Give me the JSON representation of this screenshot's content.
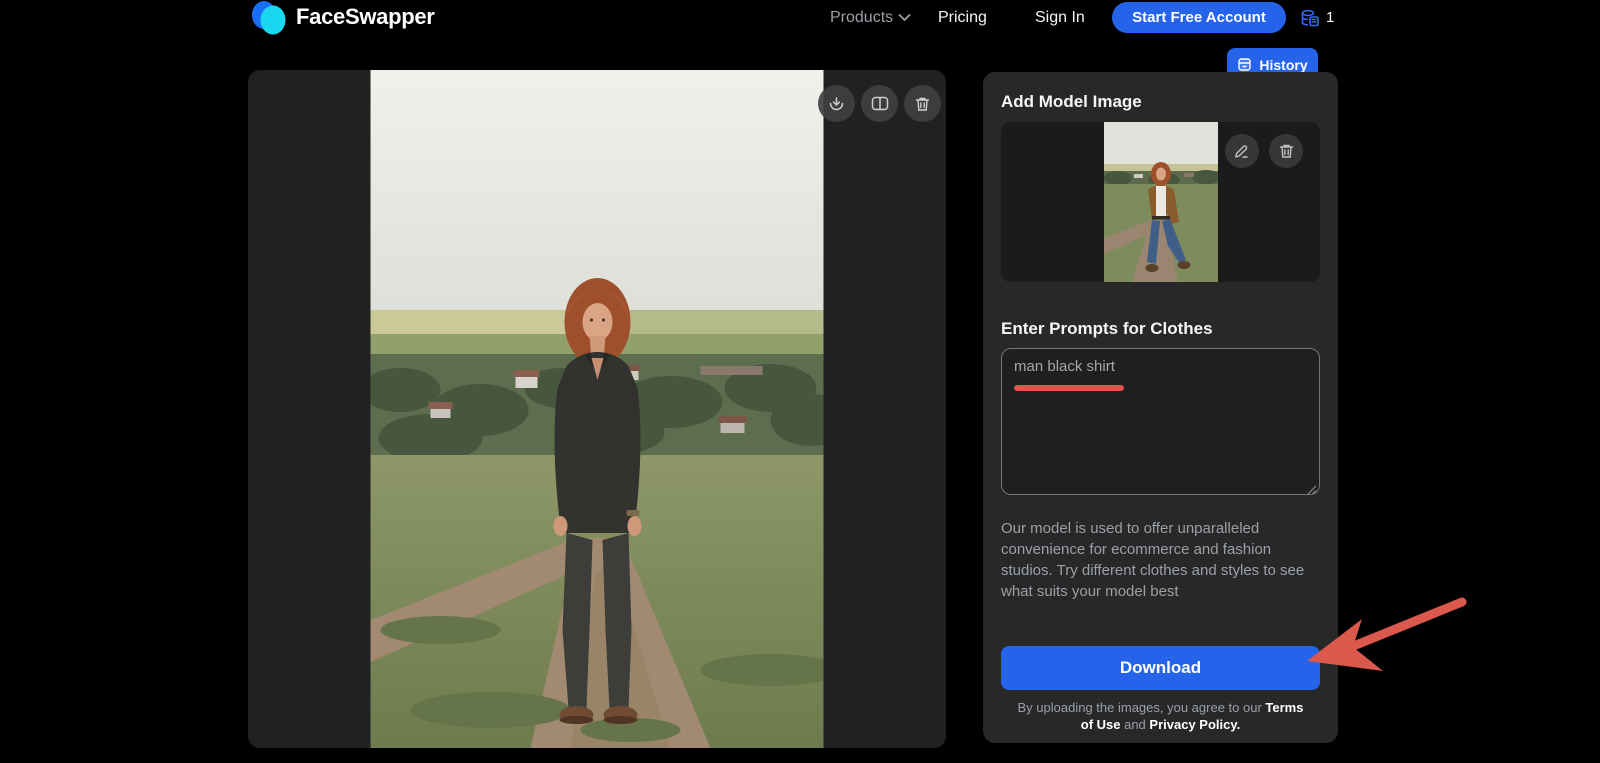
{
  "nav": {
    "brand": "FaceSwapper",
    "items": {
      "products": "Products",
      "pricing": "Pricing",
      "sign_in": "Sign In"
    },
    "cta": "Start Free Account",
    "credits": "1"
  },
  "history_button": {
    "label": "History"
  },
  "sidebar": {
    "add_model_title": "Add Model Image",
    "prompt_title": "Enter Prompts for Clothes",
    "prompt_value": "man black shirt",
    "helper_text": "Our model is used to offer unparalleled convenience for ecommerce and fashion studios. Try different clothes and styles to see what suits your model best",
    "download_label": "Download",
    "footer": {
      "prefix": "By uploading the images, you agree to our ",
      "terms": "Terms of Use",
      "and": " and ",
      "privacy": "Privacy Policy."
    }
  },
  "icons": {
    "logo": "two-overlapping-ellipses",
    "nav_chevron": "chevron-down",
    "credits": "coin-stack",
    "history": "archive-book",
    "image_actions": [
      "download-circle",
      "compare-split",
      "trash"
    ],
    "card_actions": [
      "pencil-edit",
      "trash"
    ]
  },
  "colors": {
    "accent_blue": "#2563eb",
    "underline_red": "#e2544a",
    "arrow_red": "#db584c",
    "panel_dark": "#212121",
    "sidebar_dark": "#282828"
  }
}
